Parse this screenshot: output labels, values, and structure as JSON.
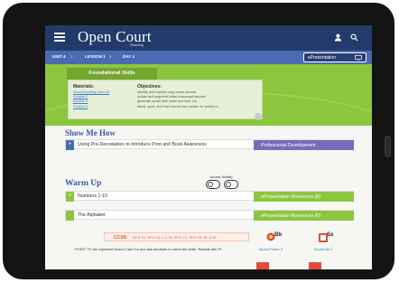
{
  "app": {
    "name": "Open Court",
    "subtitle": "Reading"
  },
  "breadcrumb": {
    "unit": "UNIT 4",
    "lesson": "LESSON 1",
    "day": "DAY 1",
    "epresentation": "ePresentation"
  },
  "foundational": {
    "tab": "Foundational Skills",
    "materials_title": "Materials:",
    "materials": [
      "Sound/Spelling Card 28",
      "Routine 2",
      "Routine 3",
      "Routine 5"
    ],
    "objectives_title": "Objectives:",
    "objectives": [
      "identify and explore long vowel sounds",
      "isolate and segment initial consonant sounds",
      "generate words with initial and final -ed",
      "blend, spell, and read words that contain /e/ spelled e_"
    ]
  },
  "show_me_how": {
    "title": "Show Me How",
    "row_label": "Using Pre-Decodables to Introduce Print and Book Awareness",
    "side": "Professional Development"
  },
  "warm_up": {
    "title": "Warm Up",
    "access_label": "Access Visibility",
    "rows": [
      {
        "toggle": "+",
        "label": "Numbers 1-10",
        "side": "ePresentation Resources (6)"
      },
      {
        "toggle": "-",
        "label": "The Alphabet",
        "side": "ePresentation Resources (6)"
      }
    ],
    "ccss_label": "CCSS:",
    "ccss_codes": "RF.K.1D, RF.K.1A, L.K.1A, RF.K.1.2, RF.K.2A, RL.K.3A",
    "body": "POINT TO the Alphabet Sound Card Go and ask students to name the letter. Repeat with Ff."
  },
  "resources": [
    {
      "label": "Alpha Poster 2",
      "tag": "Bb"
    },
    {
      "label": "Sound Bk 2",
      "tag": "Ss"
    }
  ],
  "colors": {
    "navy": "#223b6a",
    "blue": "#4a6bb4",
    "green": "#8cc63f",
    "purple": "#7b6ab8"
  }
}
